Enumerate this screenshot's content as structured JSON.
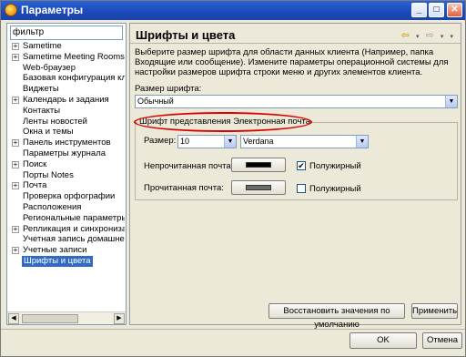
{
  "window": {
    "title": "Параметры",
    "minimize": "_",
    "maximize": "□",
    "close": "✕"
  },
  "filter": {
    "value": "фильтр"
  },
  "tree": {
    "items": [
      {
        "label": "Sametime",
        "expander": "+"
      },
      {
        "label": "Sametime Meeting Rooms",
        "expander": "+"
      },
      {
        "label": "Web-браузер",
        "expander": ""
      },
      {
        "label": "Базовая конфигурация клиен",
        "expander": ""
      },
      {
        "label": "Виджеты",
        "expander": ""
      },
      {
        "label": "Календарь и задания",
        "expander": "+"
      },
      {
        "label": "Контакты",
        "expander": ""
      },
      {
        "label": "Ленты новостей",
        "expander": ""
      },
      {
        "label": "Окна и темы",
        "expander": ""
      },
      {
        "label": "Панель инструментов",
        "expander": "+"
      },
      {
        "label": "Параметры журнала",
        "expander": ""
      },
      {
        "label": "Поиск",
        "expander": "+"
      },
      {
        "label": "Порты Notes",
        "expander": ""
      },
      {
        "label": "Почта",
        "expander": "+"
      },
      {
        "label": "Проверка орфографии",
        "expander": ""
      },
      {
        "label": "Расположения",
        "expander": ""
      },
      {
        "label": "Региональные параметры",
        "expander": ""
      },
      {
        "label": "Репликация и синхронизация",
        "expander": "+"
      },
      {
        "label": "Учетная запись домашнего п",
        "expander": ""
      },
      {
        "label": "Учетные записи",
        "expander": "+"
      },
      {
        "label": "Шрифты и цвета",
        "expander": "",
        "selected": true
      }
    ]
  },
  "page": {
    "title": "Шрифты и цвета",
    "description": "Выберите размер шрифта для области данных клиента (Например, папка Входящие или сообщение). Измените параметры операционной системы для настройки размеров шрифта строки меню и других элементов клиента.",
    "font_size_label": "Размер шрифта:",
    "font_size_value": "Обычный",
    "group_title": "Шрифт представления Электронная почта",
    "size_label": "Размер:",
    "size_value": "10",
    "font_value": "Verdana",
    "unread_label": "Непрочитанная почта:",
    "unread_color": "#000000",
    "unread_bold_label": "Полужирный",
    "unread_bold_checked": true,
    "read_label": "Прочитанная почта:",
    "read_color": "#6b6b6b",
    "read_bold_label": "Полужирный",
    "read_bold_checked": false,
    "restore_defaults": "Восстановить значения по умолчанию",
    "apply": "Применить"
  },
  "footer": {
    "ok": "OK",
    "cancel": "Отмена"
  },
  "colors": {
    "selection": "#316ac5",
    "highlight_ellipse": "#d80000"
  }
}
